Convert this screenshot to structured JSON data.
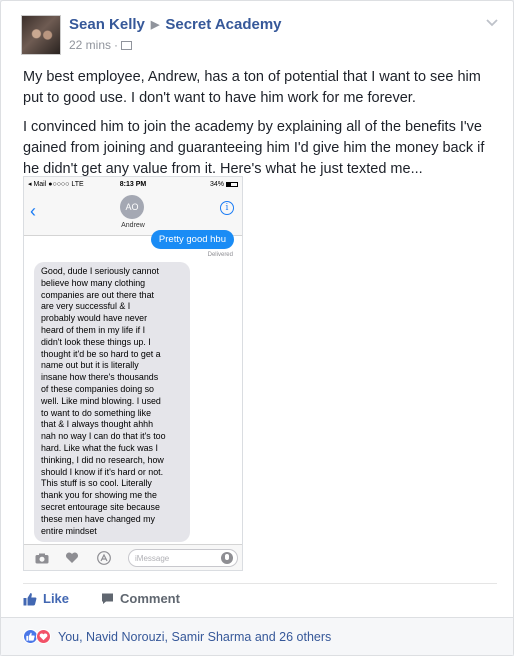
{
  "post": {
    "author": "Sean Kelly",
    "group": "Secret Academy",
    "time": "22 mins",
    "dot": "·",
    "paragraphs": [
      "My best employee, Andrew, has a ton of potential that I want to see him put to good use. I don't want to have him work for me forever.",
      "I convinced him to join the academy by explaining all of the benefits I've gained from joining and guaranteeing him I'd give him the money back if he didn't get any value from it. Here's what he just texted me..."
    ]
  },
  "phone": {
    "status": {
      "carrier": "◂ Mail ●○○○○ LTE",
      "time": "8:13 PM",
      "battery": "34%"
    },
    "contact": {
      "initials": "AO",
      "name": "Andrew"
    },
    "outgoing": "Pretty good hbu",
    "delivered": "Delivered",
    "incoming": "Good, dude I seriously cannot\nbelieve how many clothing\ncompanies are out there that\nare very successful & I\nprobably would have never\nheard of them in my life if I\ndidn't look these things up. I\nthought it'd be so hard to get a\nname out but it is literally\ninsane how there's thousands\nof these companies doing so\nwell. Like mind blowing. I used\nto want to do something like\nthat & I always thought ahhh\nnah no way I can do that it's too\nhard. Like what the fuck was I\nthinking, I did no research, how\nshould I know if it's hard or not.\nThis stuff is so cool. Literally\nthank you for showing me the\nsecret entourage site because\nthese men have changed my\nentire mindset",
    "input_placeholder": "iMessage",
    "icons": [
      "camera-icon",
      "heart-digital-touch-icon",
      "app-store-icon",
      "mic-icon"
    ]
  },
  "actions": {
    "like": "Like",
    "comment": "Comment"
  },
  "likes": {
    "text": "You, Navid Norouzi, Samir Sharma and 26 others"
  },
  "colors": {
    "link": "#365899",
    "like_blue": "#4267b2",
    "imessage_blue": "#1a8cf5",
    "love_red": "#f25268"
  }
}
